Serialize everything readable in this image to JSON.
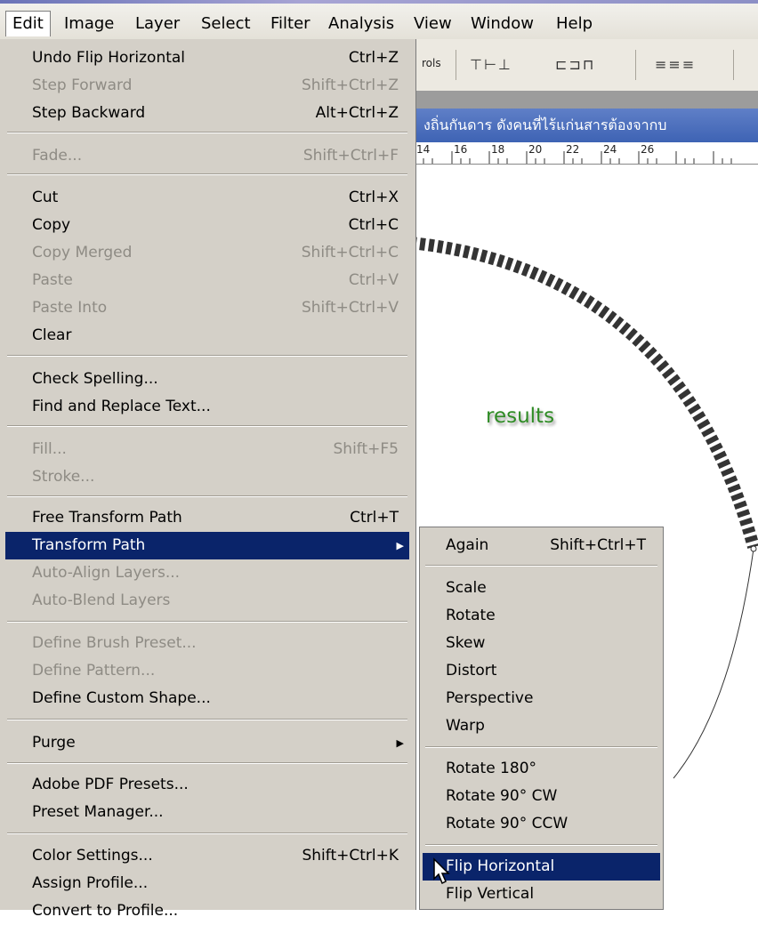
{
  "menubar": {
    "items": [
      {
        "label": "Edit",
        "accel": "E"
      },
      {
        "label": "Image",
        "accel": ""
      },
      {
        "label": "Layer",
        "accel": "L"
      },
      {
        "label": "Select",
        "accel": "S"
      },
      {
        "label": "Filter",
        "accel": ""
      },
      {
        "label": "Analysis",
        "accel": "A"
      },
      {
        "label": "View",
        "accel": "V"
      },
      {
        "label": "Window",
        "accel": "W"
      },
      {
        "label": "Help",
        "accel": "H"
      }
    ]
  },
  "options_bar": {
    "label_fragment": "rols"
  },
  "document": {
    "title_fragment": "งถิ่นกันดาร ดังคนที่ไร้แก่นสารต้องจากบ",
    "ruler_ticks": [
      "14",
      "16",
      "18",
      "20",
      "22",
      "24",
      "26"
    ],
    "canvas_text": "results"
  },
  "edit_menu": {
    "items": [
      {
        "label": "Undo Flip Horizontal",
        "shortcut": "Ctrl+Z"
      },
      {
        "label": "Step Forward",
        "shortcut": "Shift+Ctrl+Z"
      },
      {
        "label": "Step Backward",
        "shortcut": "Alt+Ctrl+Z"
      },
      {
        "label": "Fade...",
        "shortcut": "Shift+Ctrl+F"
      },
      {
        "label": "Cut",
        "shortcut": "Ctrl+X"
      },
      {
        "label": "Copy",
        "shortcut": "Ctrl+C"
      },
      {
        "label": "Copy Merged",
        "shortcut": "Shift+Ctrl+C"
      },
      {
        "label": "Paste",
        "shortcut": "Ctrl+V"
      },
      {
        "label": "Paste Into",
        "shortcut": "Shift+Ctrl+V"
      },
      {
        "label": "Clear",
        "shortcut": ""
      },
      {
        "label": "Check Spelling...",
        "shortcut": ""
      },
      {
        "label": "Find and Replace Text...",
        "shortcut": ""
      },
      {
        "label": "Fill...",
        "shortcut": "Shift+F5"
      },
      {
        "label": "Stroke...",
        "shortcut": ""
      },
      {
        "label": "Free Transform Path",
        "shortcut": "Ctrl+T"
      },
      {
        "label": "Transform Path",
        "shortcut": ""
      },
      {
        "label": "Auto-Align Layers...",
        "shortcut": ""
      },
      {
        "label": "Auto-Blend Layers",
        "shortcut": ""
      },
      {
        "label": "Define Brush Preset...",
        "shortcut": ""
      },
      {
        "label": "Define Pattern...",
        "shortcut": ""
      },
      {
        "label": "Define Custom Shape...",
        "shortcut": ""
      },
      {
        "label": "Purge",
        "shortcut": ""
      },
      {
        "label": "Adobe PDF Presets...",
        "shortcut": ""
      },
      {
        "label": "Preset Manager...",
        "shortcut": ""
      },
      {
        "label": "Color Settings...",
        "shortcut": "Shift+Ctrl+K"
      },
      {
        "label": "Assign Profile...",
        "shortcut": ""
      },
      {
        "label": "Convert to Profile...",
        "shortcut": ""
      }
    ]
  },
  "transform_submenu": {
    "items": [
      {
        "label": "Again",
        "shortcut": "Shift+Ctrl+T"
      },
      {
        "label": "Scale",
        "shortcut": ""
      },
      {
        "label": "Rotate",
        "shortcut": ""
      },
      {
        "label": "Skew",
        "shortcut": ""
      },
      {
        "label": "Distort",
        "shortcut": ""
      },
      {
        "label": "Perspective",
        "shortcut": ""
      },
      {
        "label": "Warp",
        "shortcut": ""
      },
      {
        "label": "Rotate 180°",
        "shortcut": ""
      },
      {
        "label": "Rotate 90° CW",
        "shortcut": ""
      },
      {
        "label": "Rotate 90° CCW",
        "shortcut": ""
      },
      {
        "label": "Flip Horizontal",
        "shortcut": ""
      },
      {
        "label": "Flip Vertical",
        "shortcut": ""
      }
    ]
  },
  "icons": {
    "submenu_arrow": "submenu-arrow-icon",
    "cursor": "mouse-pointer-icon"
  },
  "colors": {
    "menu_bg": "#d4d0c8",
    "highlight": "#0a246a",
    "title_bar": "#3e63b4",
    "results_text": "#2e8b24"
  }
}
